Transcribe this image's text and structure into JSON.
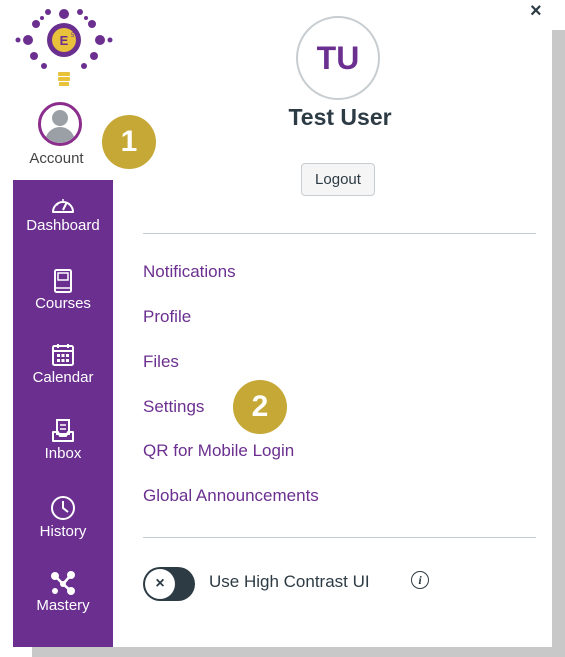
{
  "nav": {
    "account_label": "Account",
    "items": [
      {
        "label": "Dashboard",
        "icon": "dashboard-icon"
      },
      {
        "label": "Courses",
        "icon": "courses-icon"
      },
      {
        "label": "Calendar",
        "icon": "calendar-icon"
      },
      {
        "label": "Inbox",
        "icon": "inbox-icon"
      },
      {
        "label": "History",
        "icon": "history-icon"
      },
      {
        "label": "Mastery",
        "icon": "mastery-icon"
      }
    ]
  },
  "callouts": {
    "one": "1",
    "two": "2"
  },
  "tray": {
    "close": "×",
    "initials": "TU",
    "user_name": "Test User",
    "logout_label": "Logout",
    "menu": [
      "Notifications",
      "Profile",
      "Files",
      "Settings",
      "QR for Mobile Login",
      "Global Announcements"
    ],
    "toggle_knob": "×",
    "toggle_label": "Use High Contrast UI",
    "info": "i"
  },
  "colors": {
    "nav_bg": "#6b2f90",
    "link": "#6b2f90",
    "callout": "#c6a836"
  }
}
